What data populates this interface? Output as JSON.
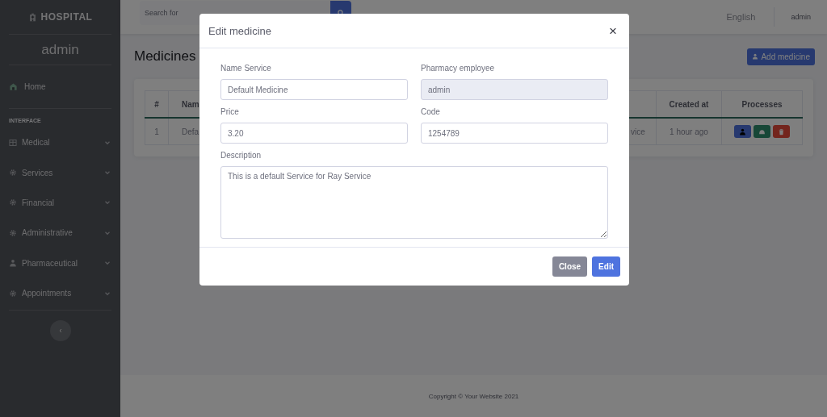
{
  "sidebar": {
    "brand": "HOSPITAL",
    "user": "admin",
    "section": "INTERFACE",
    "items": [
      {
        "kind": "link",
        "label": "Home"
      },
      {
        "kind": "group",
        "label": "Medical"
      },
      {
        "kind": "group",
        "label": "Services"
      },
      {
        "kind": "group",
        "label": "Financial"
      },
      {
        "kind": "group",
        "label": "Administrative"
      },
      {
        "kind": "group",
        "label": "Pharmaceutical"
      },
      {
        "kind": "group",
        "label": "Appointments"
      }
    ]
  },
  "topbar": {
    "search": {
      "placeholder": "Search for"
    },
    "language": "English",
    "user": "admin"
  },
  "page": {
    "title": "Medicines",
    "add_button": "Add medicine",
    "table": {
      "columns": [
        {
          "label": "#"
        },
        {
          "label": "Nam"
        },
        {},
        {
          "label": "Created at"
        },
        {
          "label": "Processes"
        }
      ],
      "rows": [
        {
          "cells": [
            "1",
            "Defa",
            "vice",
            "1 hour ago"
          ]
        }
      ]
    }
  },
  "modal": {
    "title": "Edit medicine",
    "close": "×",
    "fields": [
      {
        "kind": "input",
        "label": "Name Service",
        "value": "Default Medicine",
        "disabled": false
      },
      {
        "kind": "input",
        "label": "Pharmacy employee",
        "value": "admin",
        "disabled": true
      },
      {
        "kind": "input",
        "label": "Price",
        "value": "3.20",
        "disabled": false
      },
      {
        "kind": "input",
        "label": "Code",
        "value": "1254789",
        "disabled": false
      },
      {
        "kind": "textarea",
        "label": "Description",
        "value": "This is a default Service for Ray Service",
        "disabled": false
      }
    ],
    "buttons": [
      {
        "kind": "secondary",
        "label": "Close"
      },
      {
        "kind": "primary",
        "label": "Edit"
      }
    ]
  },
  "footer": "Copyright © Your Website 2021"
}
